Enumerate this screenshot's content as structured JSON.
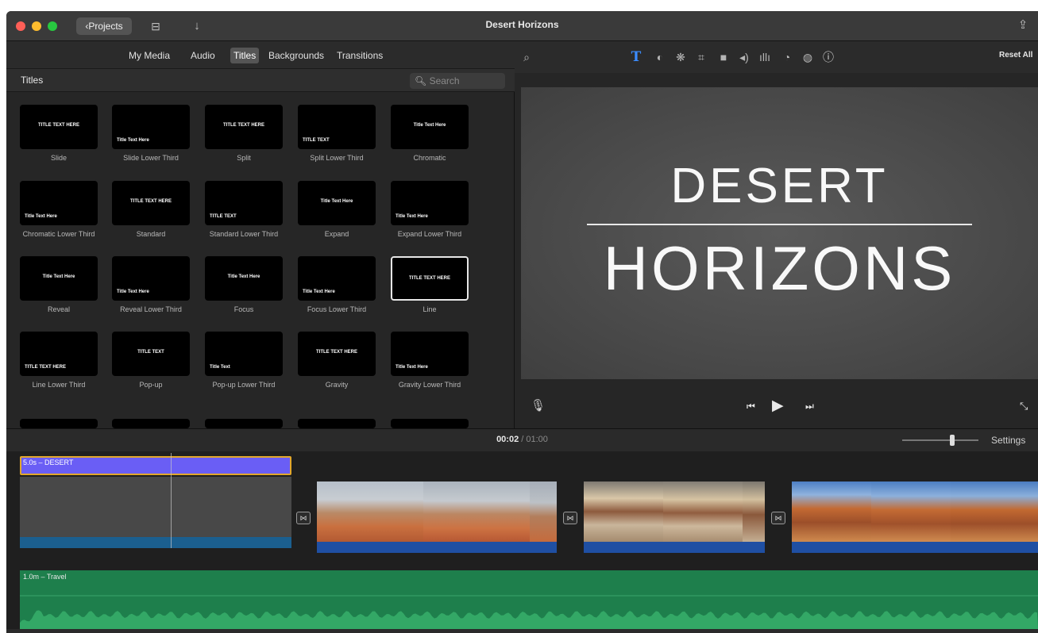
{
  "window": {
    "title": "Desert Horizons",
    "projects_button": "Projects",
    "traffic_lights": [
      "#ff5f57",
      "#febc2e",
      "#28c840"
    ]
  },
  "browser": {
    "tabs": [
      {
        "label": "My Media",
        "active": false
      },
      {
        "label": "Audio",
        "active": false
      },
      {
        "label": "Titles",
        "active": true
      },
      {
        "label": "Backgrounds",
        "active": false
      },
      {
        "label": "Transitions",
        "active": false
      }
    ],
    "section_label": "Titles",
    "search_placeholder": "Search",
    "titles": [
      {
        "name": "Slide",
        "thumb_text": "TITLE TEXT HERE"
      },
      {
        "name": "Slide Lower Third",
        "thumb_text": "Title Text Here"
      },
      {
        "name": "Split",
        "thumb_text": "TITLE TEXT HERE"
      },
      {
        "name": "Split Lower Third",
        "thumb_text": "TITLE TEXT"
      },
      {
        "name": "Chromatic",
        "thumb_text": "Title Text Here"
      },
      {
        "name": "Chromatic Lower Third",
        "thumb_text": "Title Text Here"
      },
      {
        "name": "Standard",
        "thumb_text": "TITLE TEXT HERE"
      },
      {
        "name": "Standard Lower Third",
        "thumb_text": "TITLE TEXT"
      },
      {
        "name": "Expand",
        "thumb_text": "Title Text Here"
      },
      {
        "name": "Expand Lower Third",
        "thumb_text": "Title Text Here"
      },
      {
        "name": "Reveal",
        "thumb_text": "Title Text Here"
      },
      {
        "name": "Reveal Lower Third",
        "thumb_text": "Title Text Here"
      },
      {
        "name": "Focus",
        "thumb_text": "Title Text Here"
      },
      {
        "name": "Focus Lower Third",
        "thumb_text": "Title Text Here"
      },
      {
        "name": "Line",
        "thumb_text": "TITLE TEXT HERE",
        "selected": true
      },
      {
        "name": "Line Lower Third",
        "thumb_text": "TITLE TEXT HERE"
      },
      {
        "name": "Pop-up",
        "thumb_text": "TITLE TEXT"
      },
      {
        "name": "Pop-up Lower Third",
        "thumb_text": "Title Text"
      },
      {
        "name": "Gravity",
        "thumb_text": "TITLE TEXT HERE"
      },
      {
        "name": "Gravity Lower Third",
        "thumb_text": "Title Text Here"
      }
    ]
  },
  "viewer": {
    "reset_all": "Reset All",
    "tool_icons": [
      "search-icon",
      "text-icon",
      "color-balance-icon",
      "color-correction-icon",
      "crop-icon",
      "stabilize-icon",
      "volume-icon",
      "equalizer-icon",
      "speed-icon",
      "noise-reduction-icon",
      "info-icon"
    ],
    "preview_title_line1": "DESERT",
    "preview_title_line2": "HORIZONS"
  },
  "timeline": {
    "current_time": "00:02",
    "separator": "/",
    "total_time": "01:00",
    "settings_label": "Settings",
    "title_clip_label": "5.0s – DESERT",
    "audio_clip_label": "1.0m – Travel",
    "accent_title_clip": "#6a5ef5",
    "accent_audio": "#1e7f4c"
  }
}
